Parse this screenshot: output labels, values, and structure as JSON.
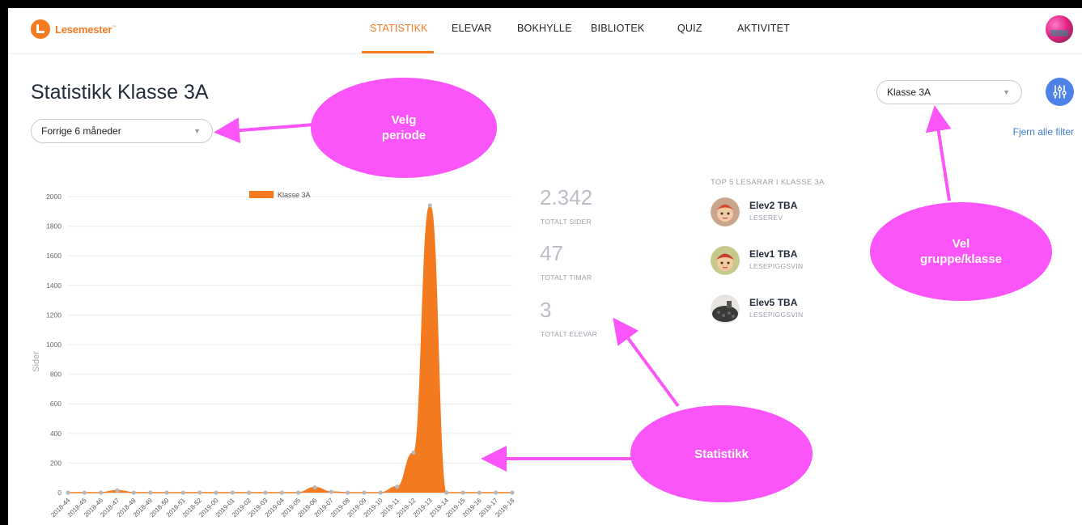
{
  "app": {
    "name": "Lesemester",
    "trademark": "™"
  },
  "nav": {
    "items": [
      {
        "label": "STATISTIKK",
        "active": true
      },
      {
        "label": "ELEVAR"
      },
      {
        "label": "BOKHYLLE"
      },
      {
        "label": "BIBLIOTEK"
      },
      {
        "label": "QUIZ"
      },
      {
        "label": "AKTIVITET"
      }
    ],
    "active_color": "#f47a20"
  },
  "page": {
    "title": "Statistikk Klasse 3A",
    "period_select": {
      "value": "Forrige 6 måneder"
    },
    "class_select": {
      "value": "Klasse 3A"
    },
    "clear_filters": "Fjern alle filter"
  },
  "stats": [
    {
      "value": "2.342",
      "label": "TOTALT SIDER"
    },
    {
      "value": "47",
      "label": "TOTALT TIMAR"
    },
    {
      "value": "3",
      "label": "TOTALT ELEVAR"
    }
  ],
  "top_readers": {
    "title": "TOP 5 LESARAR I KLASSE 3A",
    "items": [
      {
        "name": "Elev2 TBA",
        "role": "LESEREV",
        "avatar": "fox-avatar"
      },
      {
        "name": "Elev1 TBA",
        "role": "LESEPIGGSVIN",
        "avatar": "hedgehog-avatar"
      },
      {
        "name": "Elev5 TBA",
        "role": "LESEPIGGSVIN",
        "avatar": "hedgehog-dark-avatar"
      }
    ]
  },
  "annotations": {
    "period": "Velg periode",
    "group": "Vel gruppe/klasse",
    "stats": "Statistikk"
  },
  "colors": {
    "accent": "#f47a20",
    "annotation": "#fb55f9",
    "link": "#3b7bd4",
    "filter_button": "#4f82e8"
  },
  "chart_data": {
    "type": "area",
    "ylabel": "Sider",
    "xlabel": "",
    "ylim": [
      0,
      2000
    ],
    "yticks": [
      0,
      200,
      400,
      600,
      800,
      1000,
      1200,
      1400,
      1600,
      1800,
      2000
    ],
    "legend": "top",
    "grid": true,
    "categories": [
      "2018-44",
      "2018-45",
      "2018-46",
      "2018-47",
      "2018-48",
      "2018-49",
      "2018-50",
      "2018-51",
      "2018-52",
      "2019-00",
      "2019-01",
      "2019-02",
      "2019-03",
      "2019-04",
      "2019-05",
      "2019-06",
      "2019-07",
      "2019-08",
      "2019-09",
      "2019-10",
      "2019-11",
      "2019-12",
      "2019-13",
      "2019-14",
      "2019-15",
      "2019-16",
      "2019-17",
      "2019-18"
    ],
    "series": [
      {
        "name": "Klasse 3A",
        "color": "#f47a20",
        "values": [
          0,
          0,
          0,
          15,
          0,
          0,
          0,
          0,
          0,
          0,
          0,
          0,
          0,
          0,
          0,
          35,
          5,
          0,
          0,
          0,
          40,
          270,
          1940,
          0,
          0,
          0,
          0,
          0
        ]
      }
    ]
  }
}
